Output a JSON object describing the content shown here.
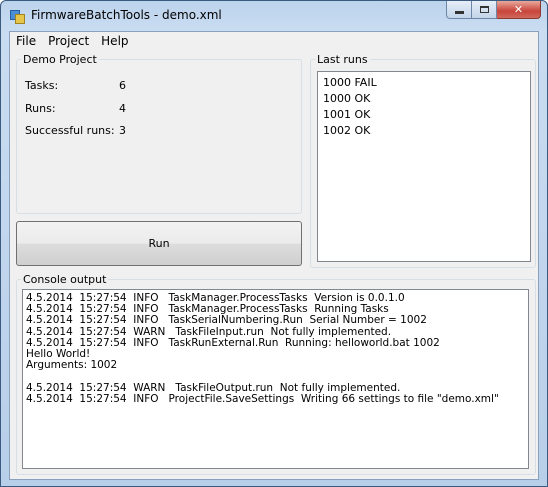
{
  "window": {
    "title": "FirmwareBatchTools - demo.xml"
  },
  "menu": {
    "file": "File",
    "project": "Project",
    "help": "Help"
  },
  "project": {
    "title": "Demo Project",
    "tasks_label": "Tasks:",
    "tasks_value": "6",
    "runs_label": "Runs:",
    "runs_value": "4",
    "success_label": "Successful runs:",
    "success_value": "3"
  },
  "run_button": {
    "label": "Run"
  },
  "last_runs": {
    "title": "Last runs",
    "items": [
      {
        "text": "1000 FAIL"
      },
      {
        "text": "1000 OK"
      },
      {
        "text": "1001 OK"
      },
      {
        "text": "1002 OK"
      }
    ]
  },
  "console": {
    "title": "Console output",
    "lines": [
      {
        "text": "4.5.2014  15:27:54  INFO   TaskManager.ProcessTasks  Version is 0.0.1.0"
      },
      {
        "text": "4.5.2014  15:27:54  INFO   TaskManager.ProcessTasks  Running Tasks"
      },
      {
        "text": "4.5.2014  15:27:54  INFO   TaskSerialNumbering.Run  Serial Number = 1002"
      },
      {
        "text": "4.5.2014  15:27:54  WARN   TaskFileInput.run  Not fully implemented."
      },
      {
        "text": "4.5.2014  15:27:54  INFO   TaskRunExternal.Run  Running: helloworld.bat 1002"
      },
      {
        "text": "Hello World!"
      },
      {
        "text": "Arguments: 1002"
      },
      {
        "text": ""
      },
      {
        "text": "4.5.2014  15:27:54  WARN   TaskFileOutput.run  Not fully implemented."
      },
      {
        "text": "4.5.2014  15:27:54  INFO   ProjectFile.SaveSettings  Writing 66 settings to file \"demo.xml\""
      }
    ]
  },
  "icons": {
    "app": "app-icon",
    "minimize": "minimize-icon",
    "maximize": "maximize-icon",
    "close": "close-icon"
  }
}
